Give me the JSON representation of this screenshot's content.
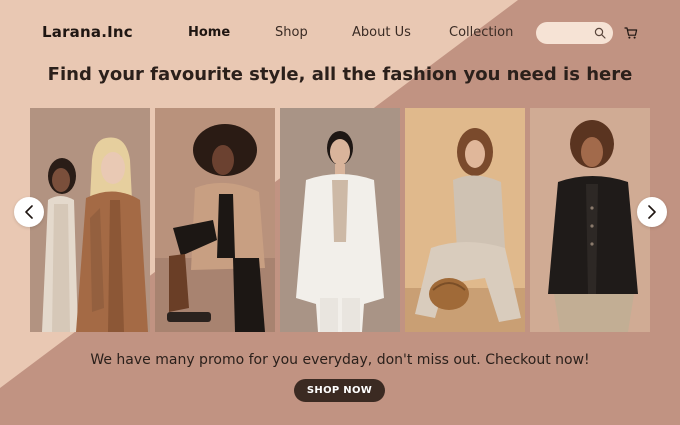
{
  "brand": {
    "name": "Larana.Inc"
  },
  "nav": {
    "items": [
      {
        "label": "Home",
        "active": true
      },
      {
        "label": "Shop",
        "active": false
      },
      {
        "label": "About Us",
        "active": false
      },
      {
        "label": "Collection",
        "active": false
      }
    ]
  },
  "search": {
    "value": "",
    "placeholder": "",
    "icon": "search-icon"
  },
  "cart": {
    "icon": "cart-icon"
  },
  "hero": {
    "headline": "Find your favourite style, all the fashion you need is here",
    "promo_text": "We have many promo for you everyday, don't miss out. Checkout now!",
    "cta_label": "SHOP NOW"
  },
  "carousel": {
    "prev_icon": "chevron-left-icon",
    "next_icon": "chevron-right-icon",
    "photos": [
      {
        "name": "two-models-camel-coats"
      },
      {
        "name": "model-tan-blazer-boots"
      },
      {
        "name": "model-white-suit"
      },
      {
        "name": "model-knit-set-basket"
      },
      {
        "name": "model-black-cardigan"
      }
    ]
  },
  "colors": {
    "background_light": "#e9c8b3",
    "background_dark": "#c19382",
    "text_dark": "#2b201b",
    "button_dark": "#3b2a22",
    "search_bg": "#f6e3d5"
  }
}
